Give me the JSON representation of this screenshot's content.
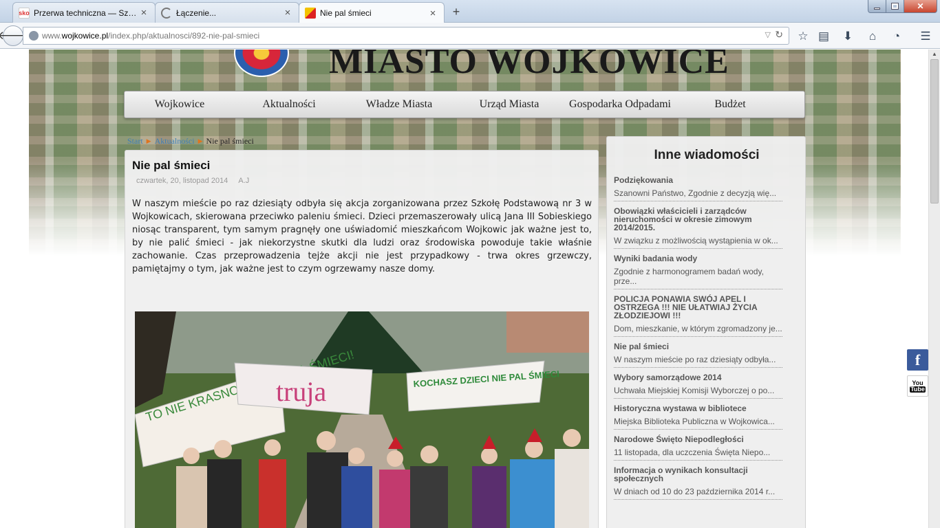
{
  "browser": {
    "tabs": [
      {
        "title": "Przerwa techniczna — Szko...",
        "favicon": "sko",
        "active": false
      },
      {
        "title": "Łączenie...",
        "favicon": "loading-icon",
        "active": false
      },
      {
        "title": "Nie pal śmieci",
        "favicon": "wojkowice-flag-icon",
        "active": true
      }
    ],
    "new_tab_symbol": "+",
    "close_symbol": "×",
    "url_prefix": "www.",
    "url_domain": "wojkowice.pl",
    "url_path": "/index.php/aktualnosci/892-nie-pal-smieci",
    "toolbar_icons": [
      "star-icon",
      "reading-list-icon",
      "download-icon",
      "home-icon",
      "history-icon",
      "menu-icon"
    ]
  },
  "site": {
    "title": "MIASTO WOJKOWICE",
    "menu": [
      "Wojkowice",
      "Aktualności",
      "Władze Miasta",
      "Urząd Miasta",
      "Gospodarka Odpadami",
      "Budżet"
    ]
  },
  "breadcrumb": {
    "start": "Start",
    "section": "Aktualności",
    "current": "Nie pal śmieci"
  },
  "article": {
    "title": "Nie pal śmieci",
    "date": "czwartek, 20, listopad 2014",
    "author": "A.J",
    "body": "W naszym mieście po raz dziesiąty odbyła się akcja zorganizowana przez Szkołę Podstawową nr 3 w Wojkowicach, skierowana przeciwko paleniu śmieci. Dzieci przemaszerowały ulicą Jana III Sobieskiego niosąc transparent, tym samym pragnęły one uświadomić mieszkańcom Wojkowic jak ważne jest to, by nie palić śmieci - jak niekorzystne skutki dla ludzi oraz środowiska powoduje takie właśnie zachowanie. Czas przeprowadzenia tejże akcji nie jest przypadkowy - trwa okres grzewczy, pamiętajmy o tym, jak ważne jest to czym ogrzewamy nasze domy.",
    "photo_banners": [
      "TO NIE KRASNOLUDKI PALĄ ŚMIECI!",
      "truja",
      "KOCHASZ DZIECI NIE PAL ŚMIECI"
    ]
  },
  "sidebar": {
    "title": "Inne wiadomości",
    "items": [
      {
        "title": "Podziękowania",
        "excerpt": "Szanowni Państwo, Zgodnie z decyzją wię..."
      },
      {
        "title": "Obowiązki właścicieli i zarządców nieruchomości w okresie zimowym 2014/2015.",
        "excerpt": "W związku z możliwością wystąpienia w ok..."
      },
      {
        "title": "Wyniki badania wody",
        "excerpt": "Zgodnie z harmonogramem badań wody, prze..."
      },
      {
        "title": "POLICJA PONAWIA SWÓJ APEL I OSTRZEGA !!! NIE UŁATWIAJ ŻYCIA ZŁODZIEJOWI !!!",
        "excerpt": "Dom, mieszkanie, w którym zgromadzony je..."
      },
      {
        "title": "Nie pal śmieci",
        "excerpt": "W naszym mieście po raz dziesiąty odbyła..."
      },
      {
        "title": "Wybory samorządowe 2014",
        "excerpt": "Uchwała Miejskiej Komisji Wyborczej o po..."
      },
      {
        "title": "Historyczna wystawa w bibliotece",
        "excerpt": "Miejska Biblioteka Publiczna w Wojkowica..."
      },
      {
        "title": "Narodowe Święto Niepodległości",
        "excerpt": "11 listopada, dla uczczenia Święta Niepo..."
      },
      {
        "title": "Informacja o wynikach konsultacji społecznych",
        "excerpt": "W dniach od 10 do 23 października 2014 r..."
      }
    ]
  },
  "social": {
    "facebook": "f",
    "youtube_top": "You",
    "youtube_bottom": "Tube"
  },
  "colors": {
    "link": "#3d7fb5",
    "crumb_arrow": "#e0741e",
    "facebook": "#3b5b9b"
  }
}
